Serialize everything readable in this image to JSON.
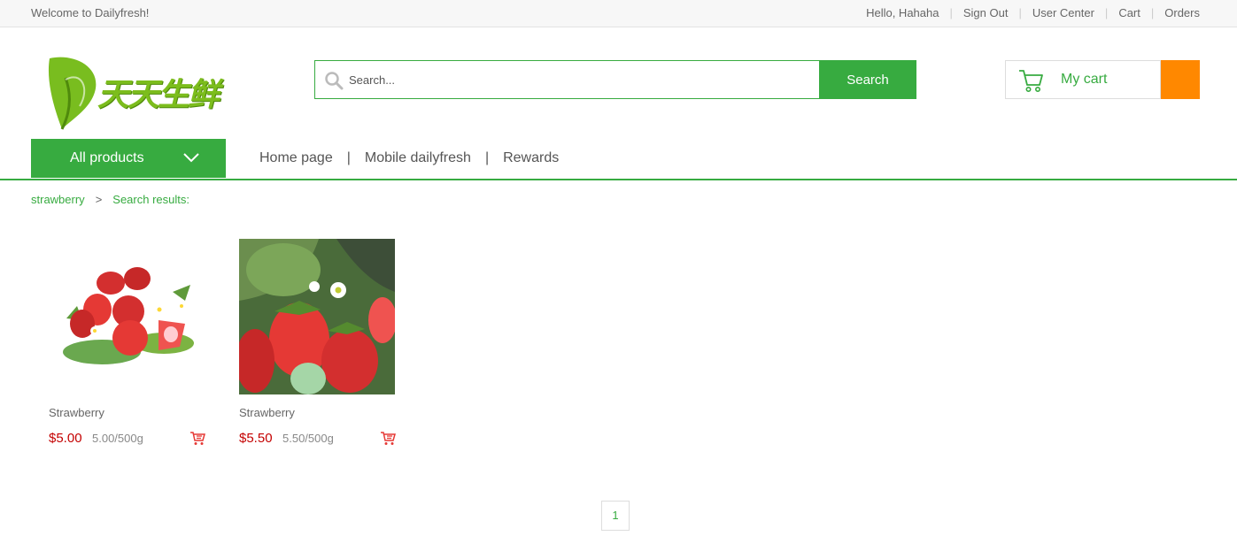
{
  "topbar": {
    "welcome": "Welcome to Dailyfresh!",
    "greeting": "Hello, Hahaha",
    "links": [
      "Sign Out",
      "User Center",
      "Cart",
      "Orders"
    ],
    "separator": "|"
  },
  "logo": {
    "text": "天天生鲜"
  },
  "search": {
    "placeholder": "Search...",
    "button_label": "Search"
  },
  "cart": {
    "label": "My cart",
    "count": ""
  },
  "nav": {
    "all_products_label": "All products",
    "links": [
      "Home page",
      "Mobile dailyfresh",
      "Rewards"
    ],
    "separator": "|"
  },
  "breadcrumb": {
    "category": "strawberry",
    "arrow": ">",
    "current": "Search results:"
  },
  "products": [
    {
      "name": "Strawberry",
      "price": "$5.00",
      "unit": "5.00/500g"
    },
    {
      "name": "Strawberry",
      "price": "$5.50",
      "unit": "5.50/500g"
    }
  ],
  "pagination": {
    "current_page": "1"
  },
  "colors": {
    "brand_green": "#37ab40",
    "cart_orange": "#ff8800",
    "price_red": "#c40000"
  },
  "icons": [
    "search-icon",
    "cart-icon",
    "chevron-down-icon",
    "add-to-cart-icon"
  ]
}
